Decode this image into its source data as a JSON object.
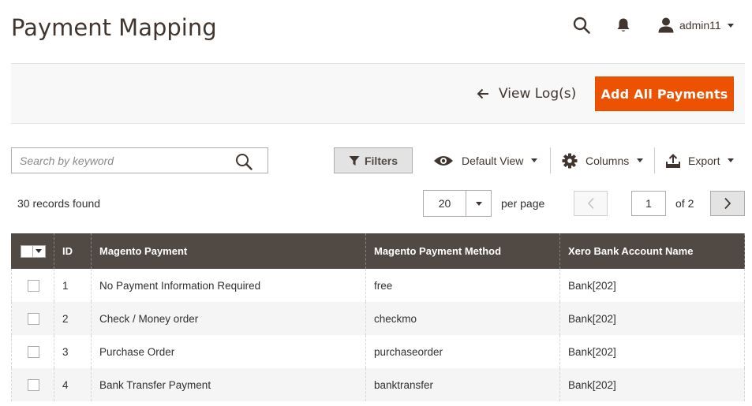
{
  "header": {
    "title": "Payment Mapping",
    "user": "admin11"
  },
  "action_bar": {
    "view_log_label": "View Log(s)",
    "add_all_label": "Add All Payments",
    "accent_color": "#eb5202"
  },
  "toolbar": {
    "search_placeholder": "Search by keyword",
    "filters_label": "Filters",
    "default_view_label": "Default View",
    "columns_label": "Columns",
    "export_label": "Export"
  },
  "pager": {
    "records_found": "30 records found",
    "per_page_value": "20",
    "per_page_label": "per page",
    "current_page": "1",
    "of_pages": "of 2"
  },
  "grid": {
    "headers": [
      "ID",
      "Magento Payment",
      "Magento Payment Method",
      "Xero Bank Account Name"
    ],
    "header_color": "#514943",
    "rows": [
      {
        "id": "1",
        "payment": "No Payment Information Required",
        "method": "free",
        "account": "Bank[202]"
      },
      {
        "id": "2",
        "payment": "Check / Money order",
        "method": "checkmo",
        "account": "Bank[202]"
      },
      {
        "id": "3",
        "payment": "Purchase Order",
        "method": "purchaseorder",
        "account": "Bank[202]"
      },
      {
        "id": "4",
        "payment": "Bank Transfer Payment",
        "method": "banktransfer",
        "account": "Bank[202]"
      }
    ]
  },
  "icons": [
    "search-icon",
    "bell-icon",
    "user-icon",
    "arrow-left-icon",
    "filter-icon",
    "eye-icon",
    "gear-icon",
    "export-icon",
    "chevron-left-icon",
    "chevron-right-icon"
  ]
}
